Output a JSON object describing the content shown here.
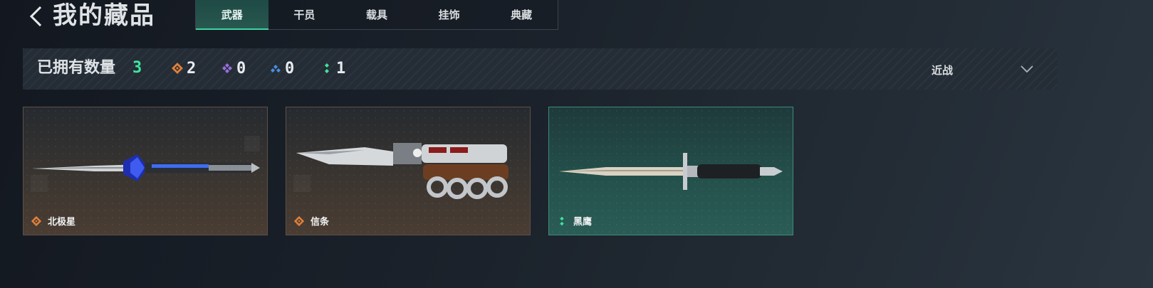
{
  "header": {
    "title": "我的藏品",
    "back_icon": "chevron-left-icon"
  },
  "tabs": [
    {
      "label": "武器",
      "active": true
    },
    {
      "label": "干员",
      "active": false
    },
    {
      "label": "载具",
      "active": false
    },
    {
      "label": "挂饰",
      "active": false
    },
    {
      "label": "典藏",
      "active": false
    }
  ],
  "stats": {
    "owned_label": "已拥有数量",
    "owned_count": "3",
    "rarities": [
      {
        "icon": "orange-diamond-icon",
        "color": "#e0803a",
        "count": "2"
      },
      {
        "icon": "purple-diamond-icon",
        "color": "#9b6fe0",
        "count": "0"
      },
      {
        "icon": "blue-diamond-icon",
        "color": "#4a8fe0",
        "count": "0"
      },
      {
        "icon": "green-diamond-icon",
        "color": "#3ee69e",
        "count": "1"
      }
    ]
  },
  "filter": {
    "selected": "近战",
    "icon": "chevron-down-icon"
  },
  "cards": [
    {
      "name": "北极星",
      "rarity": "orange",
      "rarity_color": "#e0803a"
    },
    {
      "name": "信条",
      "rarity": "orange",
      "rarity_color": "#e0803a"
    },
    {
      "name": "黑鹰",
      "rarity": "green",
      "rarity_color": "#3ee69e"
    }
  ],
  "colors": {
    "accent_green": "#3ee69e",
    "tab_active_bg": "#28584f"
  }
}
